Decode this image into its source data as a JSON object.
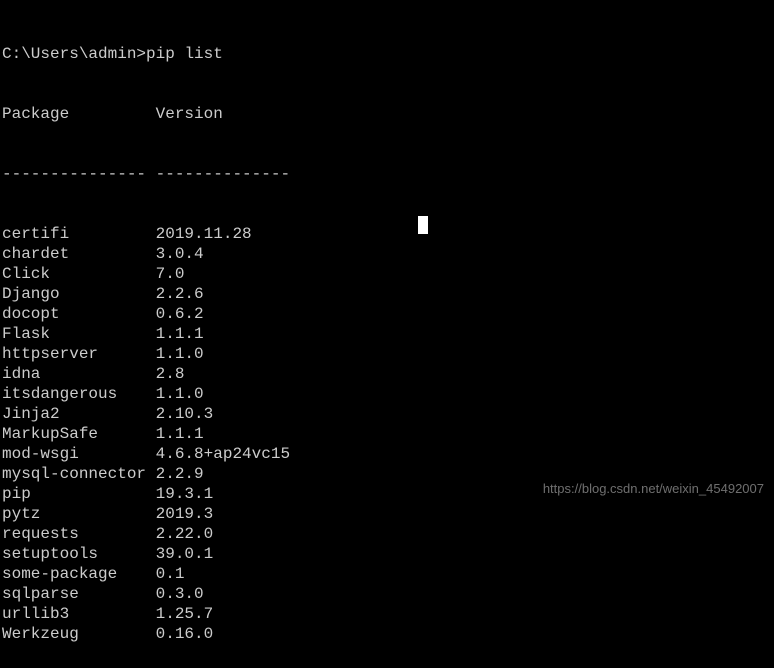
{
  "prompt": "C:\\Users\\admin>",
  "command": "pip list",
  "header": {
    "package_col": "Package",
    "version_col": "Version"
  },
  "divider": {
    "package_col": "---------------",
    "version_col": "--------------"
  },
  "packages": [
    {
      "name": "certifi",
      "version": "2019.11.28"
    },
    {
      "name": "chardet",
      "version": "3.0.4"
    },
    {
      "name": "Click",
      "version": "7.0"
    },
    {
      "name": "Django",
      "version": "2.2.6"
    },
    {
      "name": "docopt",
      "version": "0.6.2"
    },
    {
      "name": "Flask",
      "version": "1.1.1"
    },
    {
      "name": "httpserver",
      "version": "1.1.0"
    },
    {
      "name": "idna",
      "version": "2.8"
    },
    {
      "name": "itsdangerous",
      "version": "1.1.0"
    },
    {
      "name": "Jinja2",
      "version": "2.10.3"
    },
    {
      "name": "MarkupSafe",
      "version": "1.1.1"
    },
    {
      "name": "mod-wsgi",
      "version": "4.6.8+ap24vc15"
    },
    {
      "name": "mysql-connector",
      "version": "2.2.9"
    },
    {
      "name": "pip",
      "version": "19.3.1"
    },
    {
      "name": "pytz",
      "version": "2019.3"
    },
    {
      "name": "requests",
      "version": "2.22.0"
    },
    {
      "name": "setuptools",
      "version": "39.0.1"
    },
    {
      "name": "some-package",
      "version": "0.1"
    },
    {
      "name": "sqlparse",
      "version": "0.3.0"
    },
    {
      "name": "urllib3",
      "version": "1.25.7"
    },
    {
      "name": "Werkzeug",
      "version": "0.16.0"
    }
  ],
  "watermark_text": "https://blog.csdn.net/weixin_45492007"
}
